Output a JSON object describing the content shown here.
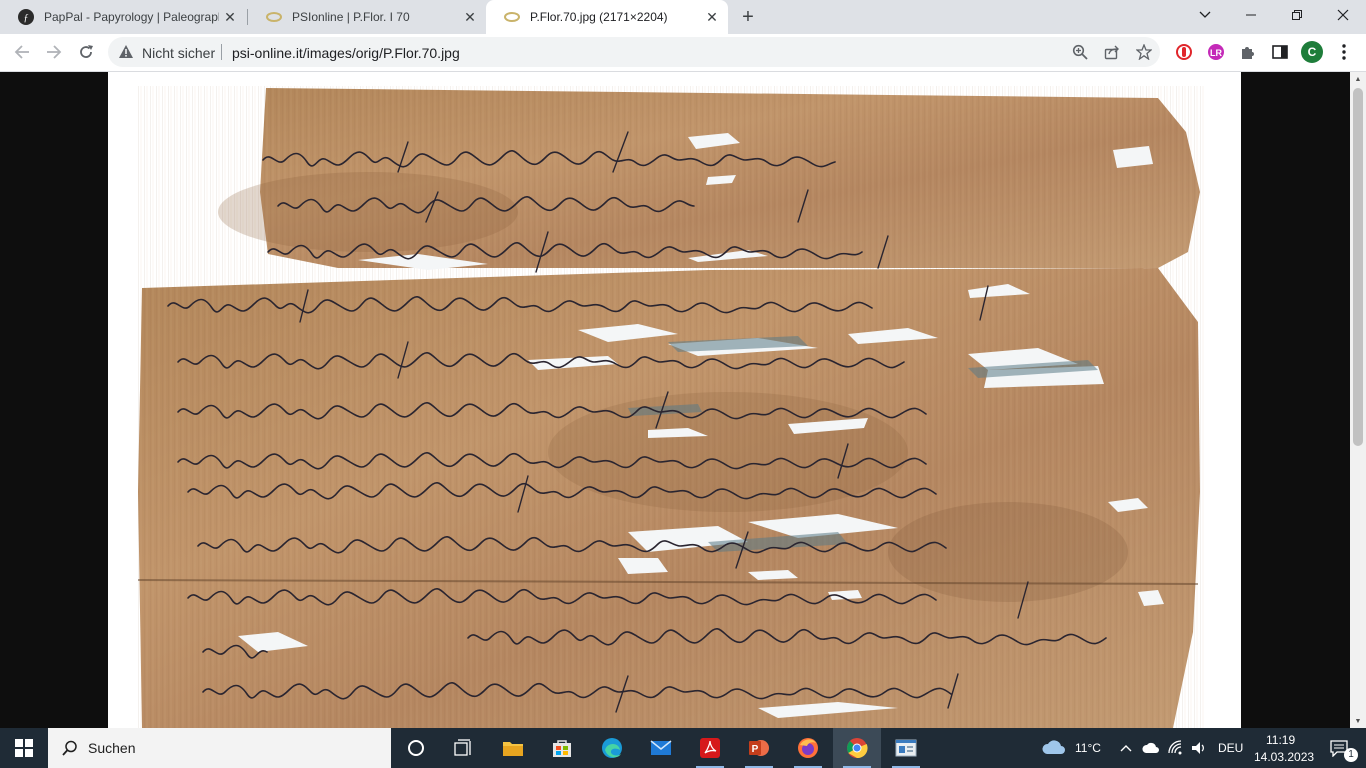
{
  "browser": {
    "tabs": [
      {
        "title": "PapPal - Papyrology | Paleography",
        "active": false
      },
      {
        "title": "PSIonline | P.Flor. I 70",
        "active": false
      },
      {
        "title": "P.Flor.70.jpg (2171×2204)",
        "active": true
      }
    ],
    "security_label": "Nicht sicher",
    "url": "psi-online.it/images/orig/P.Flor.70.jpg",
    "profile_initial": "C"
  },
  "taskbar": {
    "search_label": "Suchen",
    "weather": "11°C",
    "language": "DEU",
    "time": "11:19",
    "date": "14.03.2023",
    "notification_count": "1"
  },
  "colors": {
    "papyrus": "#b88a5a",
    "ink": "#2a2530",
    "taskbar": "#1f2b36"
  }
}
